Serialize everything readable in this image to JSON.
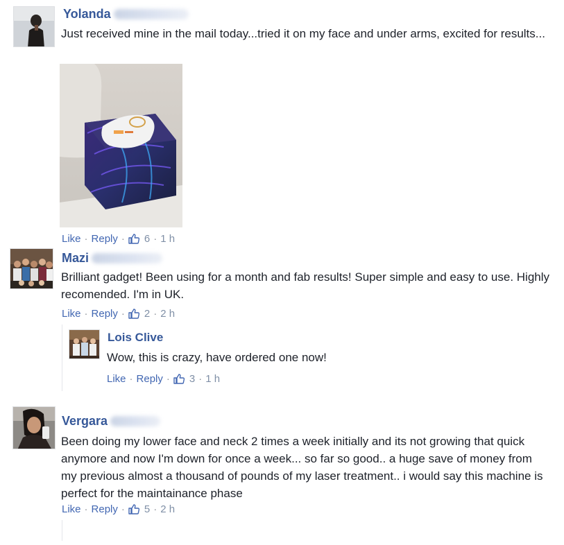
{
  "comments": [
    {
      "name": "Yolanda",
      "text": "Just received mine in the mail today...tried it on my face and under arms, excited for results...",
      "like": "Like",
      "reply": "Reply",
      "count": "6",
      "time": "1 h",
      "photo_alt": "Device on a tropical-print box"
    },
    {
      "name": "Mazi",
      "text": "Brilliant gadget! Been using for a month and fab results! Super simple and easy to use. Highly recomended. I'm in UK.",
      "like": "Like",
      "reply": "Reply",
      "count": "2",
      "time": "2 h"
    },
    {
      "name": "Lois Clive",
      "text": "Wow, this is crazy, have ordered one now!",
      "like": "Like",
      "reply": "Reply",
      "count": "3",
      "time": "1 h"
    },
    {
      "name": "Vergara",
      "text": "Been doing my lower face and neck 2 times a week initially and its not growing that quick anymore and now I'm down for once a week... so far so good.. a huge save of money from my previous almost a thousand of pounds of my laser treatment.. i would say this machine is perfect for the maintainance phase",
      "like": "Like",
      "reply": "Reply",
      "count": "5",
      "time": "2 h"
    }
  ],
  "icons": {
    "like": "thumbs-up-icon"
  },
  "colors": {
    "name": "#365899",
    "link": "#4267b2",
    "meta": "#90949c",
    "text": "#1d2129"
  }
}
